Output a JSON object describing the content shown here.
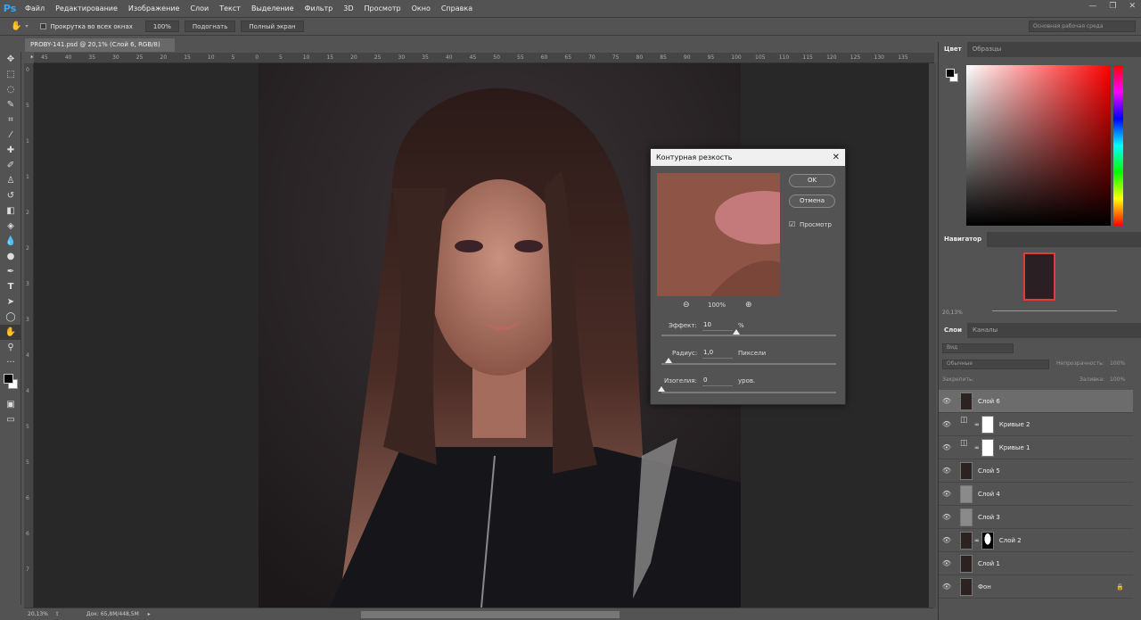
{
  "app": {
    "logo": "Ps"
  },
  "menu": [
    "Файл",
    "Редактирование",
    "Изображение",
    "Слои",
    "Текст",
    "Выделение",
    "Фильтр",
    "3D",
    "Просмотр",
    "Окно",
    "Справка"
  ],
  "options": {
    "scroll_all": "Прокрутка во всех окнах",
    "zoom_100": "100%",
    "fit": "Подогнать",
    "fullscreen": "Полный экран",
    "workspace": "Основная рабочая среда"
  },
  "document": {
    "tab": "PROBY-141.psd @ 20,1% (Слой 6, RGB/8) *",
    "zoom": "20,13%",
    "doc_size": "Док: 65,8M/448,5M"
  },
  "ruler_h": [
    "45",
    "40",
    "35",
    "30",
    "25",
    "20",
    "15",
    "10",
    "5",
    "0",
    "5",
    "10",
    "15",
    "20",
    "25",
    "30",
    "35",
    "40",
    "45",
    "50",
    "55",
    "60",
    "65",
    "70",
    "75",
    "80",
    "85",
    "90",
    "95",
    "100",
    "105",
    "110",
    "115",
    "120",
    "125",
    "130",
    "135"
  ],
  "ruler_v": [
    "0",
    "5",
    "1",
    "1",
    "2",
    "2",
    "3",
    "3",
    "4",
    "4",
    "5",
    "5",
    "6",
    "6",
    "7"
  ],
  "dialog": {
    "title": "Контурная резкость",
    "ok": "OK",
    "cancel": "Отмена",
    "preview": "Просмотр",
    "preview_zoom": "100%",
    "amount_label": "Эффект:",
    "amount_value": "10",
    "amount_unit": "%",
    "amount_pct": 0.43,
    "radius_label": "Радиус:",
    "radius_value": "1,0",
    "radius_unit": "Пиксели",
    "radius_pct": 0.04,
    "threshold_label": "Изогелия:",
    "threshold_value": "0",
    "threshold_unit": "уров.",
    "threshold_pct": 0.0
  },
  "color_panel": {
    "tabs": [
      "Цвет",
      "Образцы"
    ]
  },
  "navigator": {
    "title": "Навигатор",
    "zoom": "20,13%"
  },
  "layers_panel": {
    "tabs": [
      "Слои",
      "Каналы"
    ],
    "kind": "Вид",
    "blend": "Обычные",
    "opacity_label": "Непрозрачность:",
    "opacity": "100%",
    "lock_label": "Закрепить:",
    "fill_label": "Заливка:",
    "fill": "100%",
    "layers": [
      {
        "name": "Слой 6",
        "type": "photo",
        "active": true
      },
      {
        "name": "Кривые 2",
        "type": "curves"
      },
      {
        "name": "Кривые 1",
        "type": "curves"
      },
      {
        "name": "Слой 5",
        "type": "photo"
      },
      {
        "name": "Слой 4",
        "type": "gray"
      },
      {
        "name": "Слой 3",
        "type": "gray"
      },
      {
        "name": "Слой 2",
        "type": "mask"
      },
      {
        "name": "Слой 1",
        "type": "photo"
      },
      {
        "name": "Фон",
        "type": "photo",
        "locked": true
      }
    ]
  }
}
